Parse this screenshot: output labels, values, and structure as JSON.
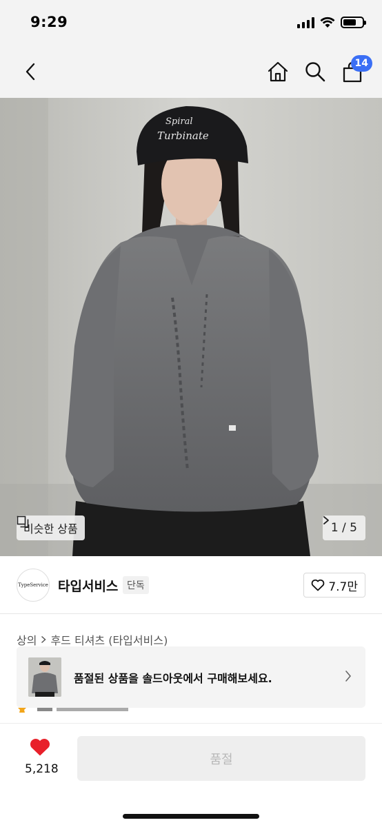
{
  "status": {
    "time": "9:29"
  },
  "nav": {
    "cart_count": "14"
  },
  "hero": {
    "similar_label": "비슷한 상품",
    "pager": "1 / 5"
  },
  "brand": {
    "logo_text": "TypeService",
    "name": "타입서비스",
    "tag": "단독",
    "like_count": "7.7만"
  },
  "breadcrumb": {
    "category": "상의",
    "subcategory": "후드 티셔츠 (타입서비스)"
  },
  "soldout_banner": {
    "text": "품절된 상품을 솔드아웃에서 구매해보세요."
  },
  "bottom": {
    "wish_count": "5,218",
    "buy_label": "품절"
  },
  "colors": {
    "accent": "#3b6ff5",
    "heart": "#e8202a"
  }
}
